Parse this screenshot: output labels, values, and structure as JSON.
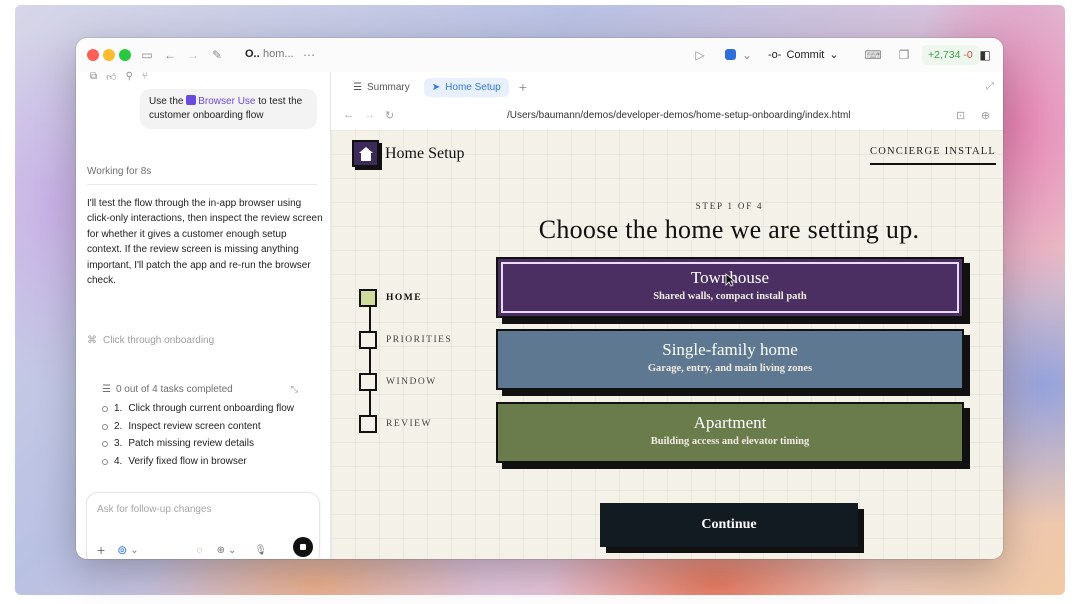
{
  "titlebar": {
    "title_short": "O..",
    "title_path": "hom...",
    "commit_label": "Commit",
    "diff_added": "+2,734",
    "diff_removed": "-0"
  },
  "chat": {
    "user_message_prefix": "Use the",
    "user_message_chip": "Browser Use",
    "user_message_suffix": "to test the customer onboarding flow",
    "working_status": "Working for 8s",
    "assistant_message": "I'll test the flow through the in-app browser using click-only interactions, then inspect the review screen for whether it gives a customer enough setup context. If the review screen is missing anything important, I'll patch the app and re-run the browser check.",
    "current_step": "Click through onboarding",
    "tasks_summary": "0 out of 4 tasks completed",
    "tasks": [
      {
        "num": "1.",
        "label": "Click through current onboarding flow"
      },
      {
        "num": "2.",
        "label": "Inspect review screen content"
      },
      {
        "num": "3.",
        "label": "Patch missing review details"
      },
      {
        "num": "4.",
        "label": "Verify fixed flow in browser"
      }
    ],
    "composer_placeholder": "Ask for follow-up changes"
  },
  "browser": {
    "tabs": [
      {
        "label": "Summary",
        "active": false
      },
      {
        "label": "Home Setup",
        "active": true
      }
    ],
    "url": "/Users/baumann/demos/developer-demos/home-setup-onboarding/index.html"
  },
  "page": {
    "brand": "Home Setup",
    "concierge": "CONCIERGE INSTALL",
    "step": "STEP 1 OF 4",
    "headline": "Choose the home we are setting up.",
    "sidenav": [
      {
        "label": "HOME",
        "active": true
      },
      {
        "label": "PRIORITIES",
        "active": false
      },
      {
        "label": "WINDOW",
        "active": false
      },
      {
        "label": "REVIEW",
        "active": false
      }
    ],
    "options": [
      {
        "title": "Townhouse",
        "subtitle": "Shared walls, compact install path",
        "color": "#4b2f63",
        "selected": true
      },
      {
        "title": "Single-family home",
        "subtitle": "Garage, entry, and main living zones",
        "color": "#5f7891",
        "selected": false
      },
      {
        "title": "Apartment",
        "subtitle": "Building access and elevator timing",
        "color": "#6b7c4c",
        "selected": false
      }
    ],
    "continue_label": "Continue"
  },
  "colors": {
    "accent_blue": "#3575e6",
    "browser_use_purple": "#6c4ae0",
    "page_bg": "#f4f1e8",
    "step_done": "#d0dc9f"
  }
}
